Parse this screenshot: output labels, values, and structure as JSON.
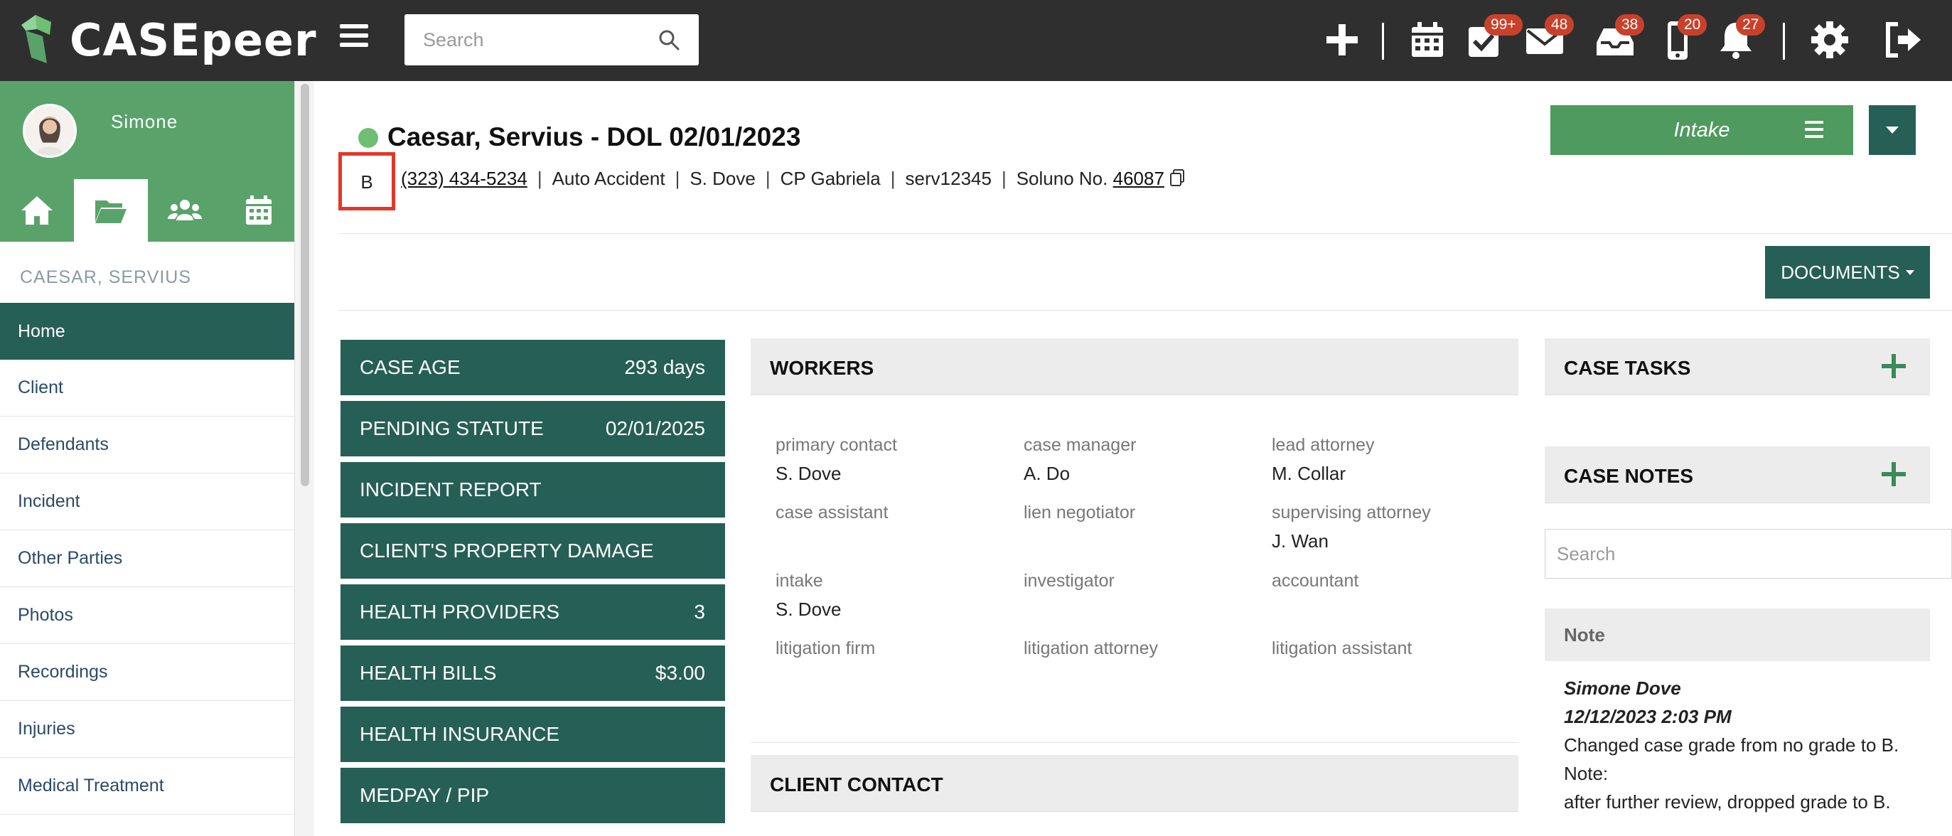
{
  "app": {
    "logo_text": "CASEpeer"
  },
  "search": {
    "placeholder": "Search"
  },
  "badges": {
    "tasks": "99+",
    "mail": "48",
    "inbox": "38",
    "phone": "20",
    "alerts": "27"
  },
  "colors": {
    "topbar": "#2f2f2f",
    "sidebar_green": "#59a36b",
    "dark_teal": "#265f55",
    "badge_red": "#c9412b",
    "grade_outline": "#e3372a",
    "status_dot": "#6fbf73"
  },
  "user": {
    "name": "Simone"
  },
  "sidebar": {
    "case_label": "CAESAR, SERVIUS",
    "tabs": [
      "home-icon",
      "folder-open-icon",
      "users-icon",
      "calendar-icon"
    ],
    "items": [
      "Home",
      "Client",
      "Defendants",
      "Incident",
      "Other Parties",
      "Photos",
      "Recordings",
      "Injuries",
      "Medical Treatment"
    ]
  },
  "case": {
    "title": "Caesar, Servius - DOL 02/01/2023",
    "grade": "B",
    "phone": "(323) 434-5234",
    "case_type": "Auto Accident",
    "staff": "S. Dove",
    "cp": "CP Gabriela",
    "client_id": "serv12345",
    "soluno_label": "Soluno No.",
    "soluno_number": "46087",
    "separator": "|"
  },
  "actions": {
    "intake_label": "Intake",
    "documents_label": "DOCUMENTS"
  },
  "stats": [
    {
      "label": "CASE AGE",
      "value": "293 days"
    },
    {
      "label": "PENDING STATUTE",
      "value": "02/01/2025"
    },
    {
      "label": "INCIDENT REPORT",
      "value": ""
    },
    {
      "label": "CLIENT'S PROPERTY DAMAGE",
      "value": ""
    },
    {
      "label": "HEALTH PROVIDERS",
      "value": "3"
    },
    {
      "label": "HEALTH BILLS",
      "value": "$3.00"
    },
    {
      "label": "HEALTH INSURANCE",
      "value": ""
    },
    {
      "label": "MEDPAY / PIP",
      "value": ""
    }
  ],
  "workers": {
    "title": "WORKERS",
    "items": [
      {
        "label": "primary contact",
        "value": "S. Dove"
      },
      {
        "label": "case manager",
        "value": "A. Do"
      },
      {
        "label": "lead attorney",
        "value": "M. Collar"
      },
      {
        "label": "case assistant",
        "value": ""
      },
      {
        "label": "lien negotiator",
        "value": ""
      },
      {
        "label": "supervising attorney",
        "value": "J. Wan"
      },
      {
        "label": "intake",
        "value": "S. Dove"
      },
      {
        "label": "investigator",
        "value": ""
      },
      {
        "label": "accountant",
        "value": ""
      },
      {
        "label": "litigation firm",
        "value": ""
      },
      {
        "label": "litigation attorney",
        "value": ""
      },
      {
        "label": "litigation assistant",
        "value": ""
      }
    ]
  },
  "client_contact": {
    "title": "CLIENT CONTACT"
  },
  "case_tasks": {
    "title": "CASE TASKS"
  },
  "case_notes": {
    "title": "CASE NOTES",
    "search_placeholder": "Search",
    "column_header": "Note",
    "note": {
      "author": "Simone Dove",
      "timestamp": "12/12/2023 2:03 PM",
      "line1": "Changed case grade from no grade to B.",
      "line2": "Note:",
      "line3": "after further review, dropped grade to B."
    }
  }
}
